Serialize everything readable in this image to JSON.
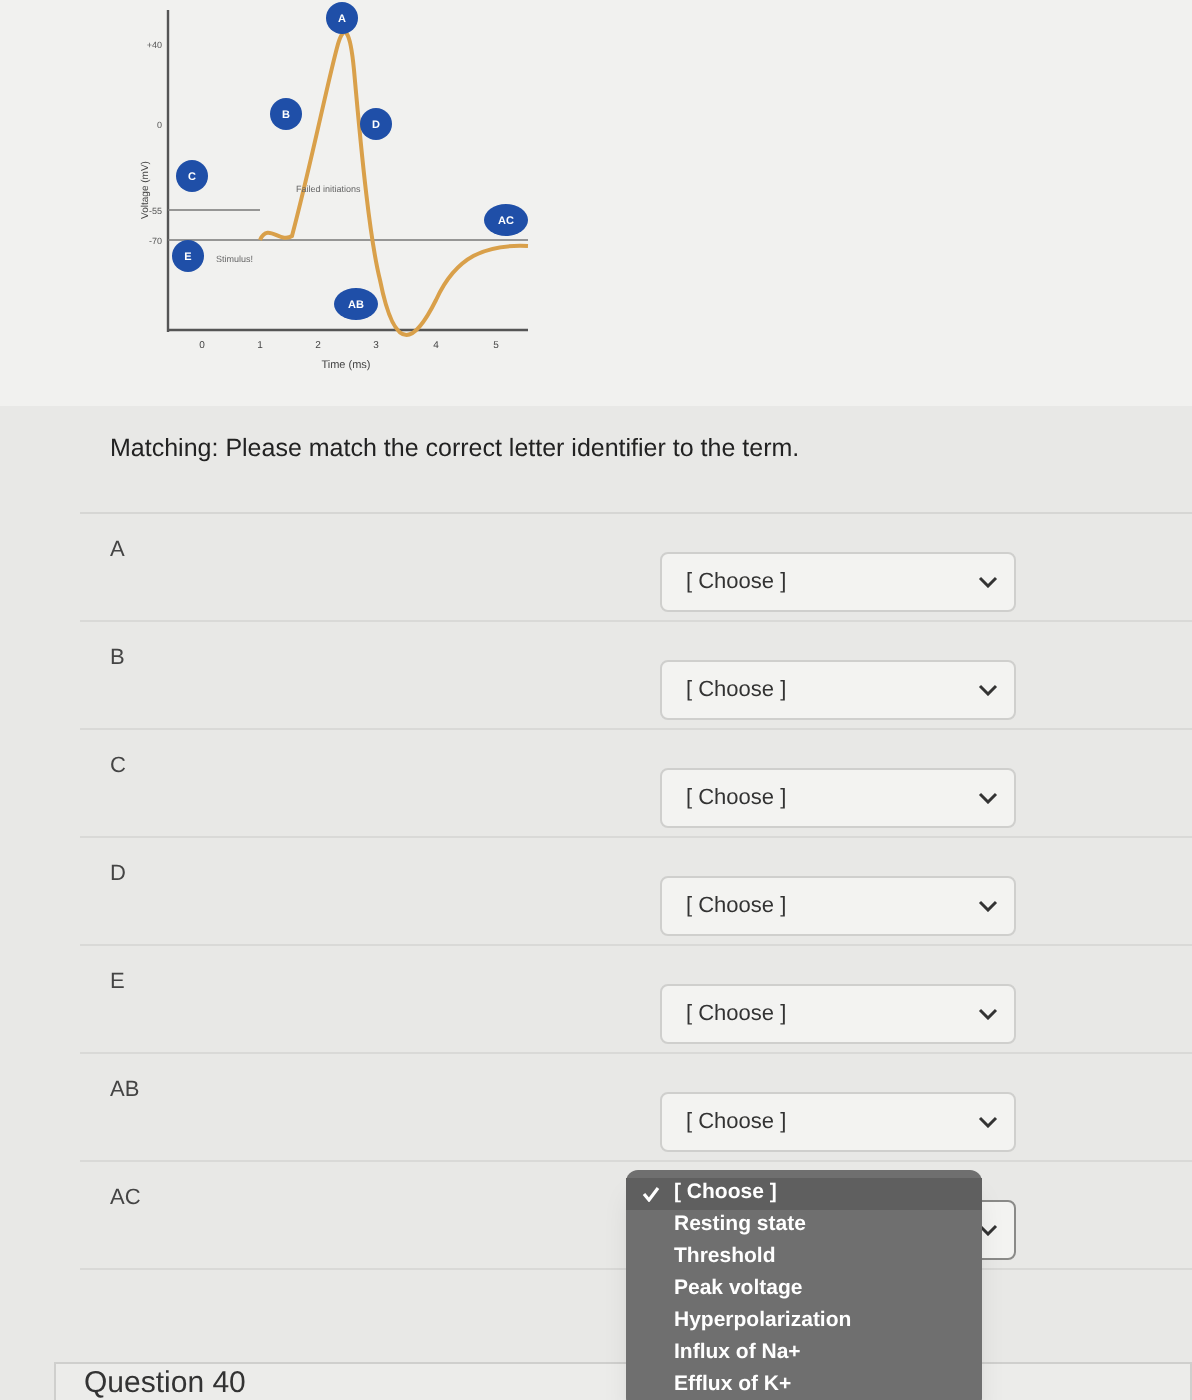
{
  "figure": {
    "y_label": "Voltage (mV)",
    "x_label": "Time (ms)",
    "y_ticks": [
      "+40",
      "0",
      "-55",
      "-70"
    ],
    "x_ticks": [
      "0",
      "1",
      "2",
      "3",
      "4",
      "5"
    ],
    "markers": [
      "A",
      "B",
      "C",
      "D",
      "E",
      "AB",
      "AC"
    ],
    "annotations": [
      "Failed initiations",
      "Stimulus!"
    ]
  },
  "prompt": {
    "lead": "Matching:",
    "text": "Please match the correct letter identifier to the term."
  },
  "rows": [
    {
      "term": "A",
      "value": "[ Choose ]",
      "open": false
    },
    {
      "term": "B",
      "value": "[ Choose ]",
      "open": false
    },
    {
      "term": "C",
      "value": "[ Choose ]",
      "open": false
    },
    {
      "term": "D",
      "value": "[ Choose ]",
      "open": false
    },
    {
      "term": "E",
      "value": "[ Choose ]",
      "open": false
    },
    {
      "term": "AB",
      "value": "[ Choose ]",
      "open": false
    },
    {
      "term": "AC",
      "open": true,
      "options": [
        {
          "label": "[ Choose ]",
          "selected": true
        },
        {
          "label": "Resting state",
          "selected": false
        },
        {
          "label": "Threshold",
          "selected": false
        },
        {
          "label": "Peak voltage",
          "selected": false
        },
        {
          "label": "Hyperpolarization",
          "selected": false
        },
        {
          "label": "Influx of Na+",
          "selected": false
        },
        {
          "label": "Efflux of K+",
          "selected": false
        }
      ]
    }
  ],
  "next_question": "Question 40"
}
